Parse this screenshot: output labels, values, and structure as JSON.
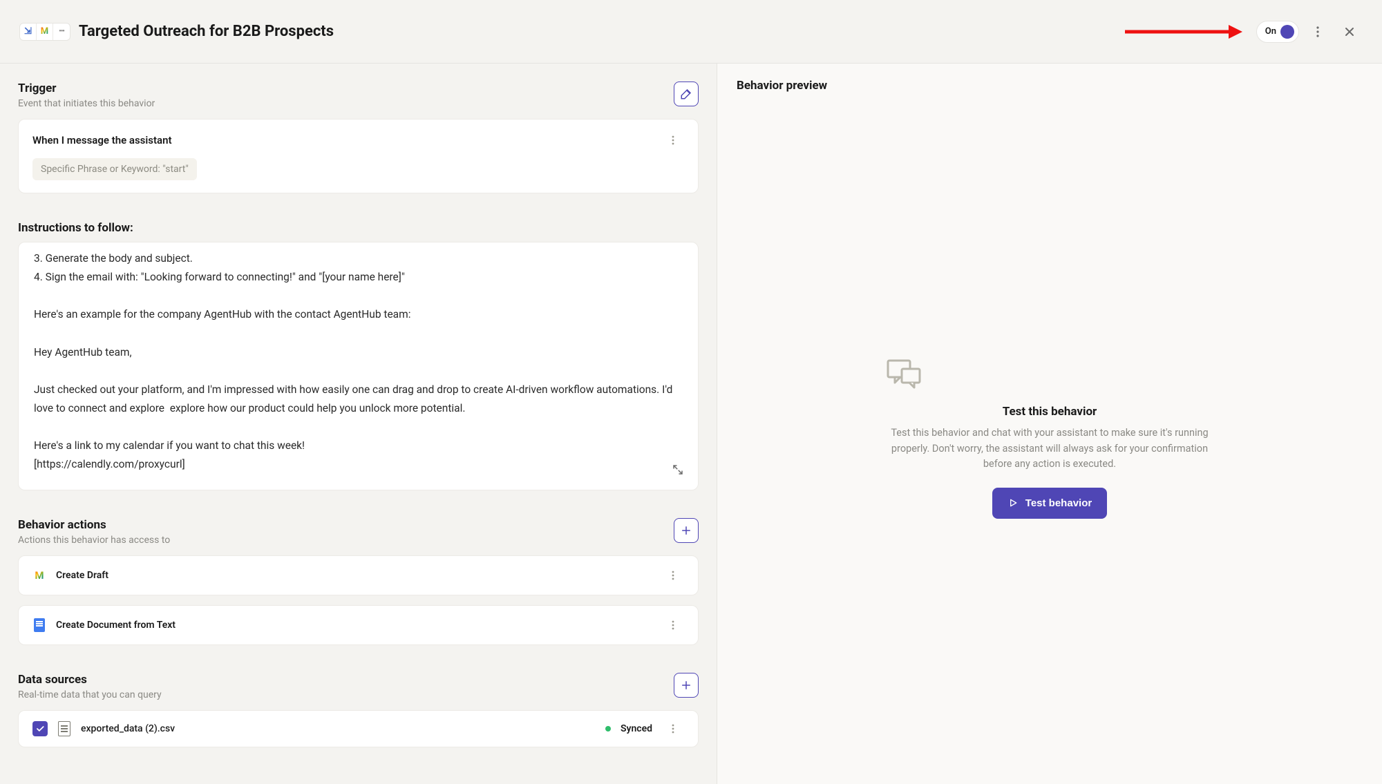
{
  "header": {
    "title": "Targeted Outreach for B2B Prospects",
    "toggle_label": "On"
  },
  "trigger": {
    "title": "Trigger",
    "subtitle": "Event that initiates this behavior",
    "card_title": "When I message the assistant",
    "phrase_label": "Specific Phrase or Keyword: ",
    "phrase_value": "\"start\""
  },
  "instructions": {
    "title": "Instructions to follow:",
    "body": "3. Generate the body and subject.\n4. Sign the email with: \"Looking forward to connecting!\" and \"[your name here]\"\n\nHere's an example for the company AgentHub with the contact AgentHub team:\n\nHey AgentHub team,\n\nJust checked out your platform, and I'm impressed with how easily one can drag and drop to create AI-driven workflow automations. I'd love to connect and explore  explore how our product could help you unlock more potential.\n\nHere's a link to my calendar if you want to chat this week!\n[https://calendly.com/proxycurl]"
  },
  "actions": {
    "title": "Behavior actions",
    "subtitle": "Actions this behavior has access to",
    "items": [
      {
        "icon": "gmail",
        "label": "Create Draft"
      },
      {
        "icon": "doc",
        "label": "Create Document from Text"
      }
    ]
  },
  "data_sources": {
    "title": "Data sources",
    "subtitle": "Real-time data that you can query",
    "items": [
      {
        "filename": "exported_data (2).csv",
        "status": "Synced",
        "checked": true
      }
    ]
  },
  "preview": {
    "header": "Behavior preview",
    "title": "Test this behavior",
    "description": "Test this behavior and chat with your assistant to make sure it's running properly. Don't worry, the assistant will always ask for your confirmation before any action is executed.",
    "button_label": "Test behavior"
  }
}
